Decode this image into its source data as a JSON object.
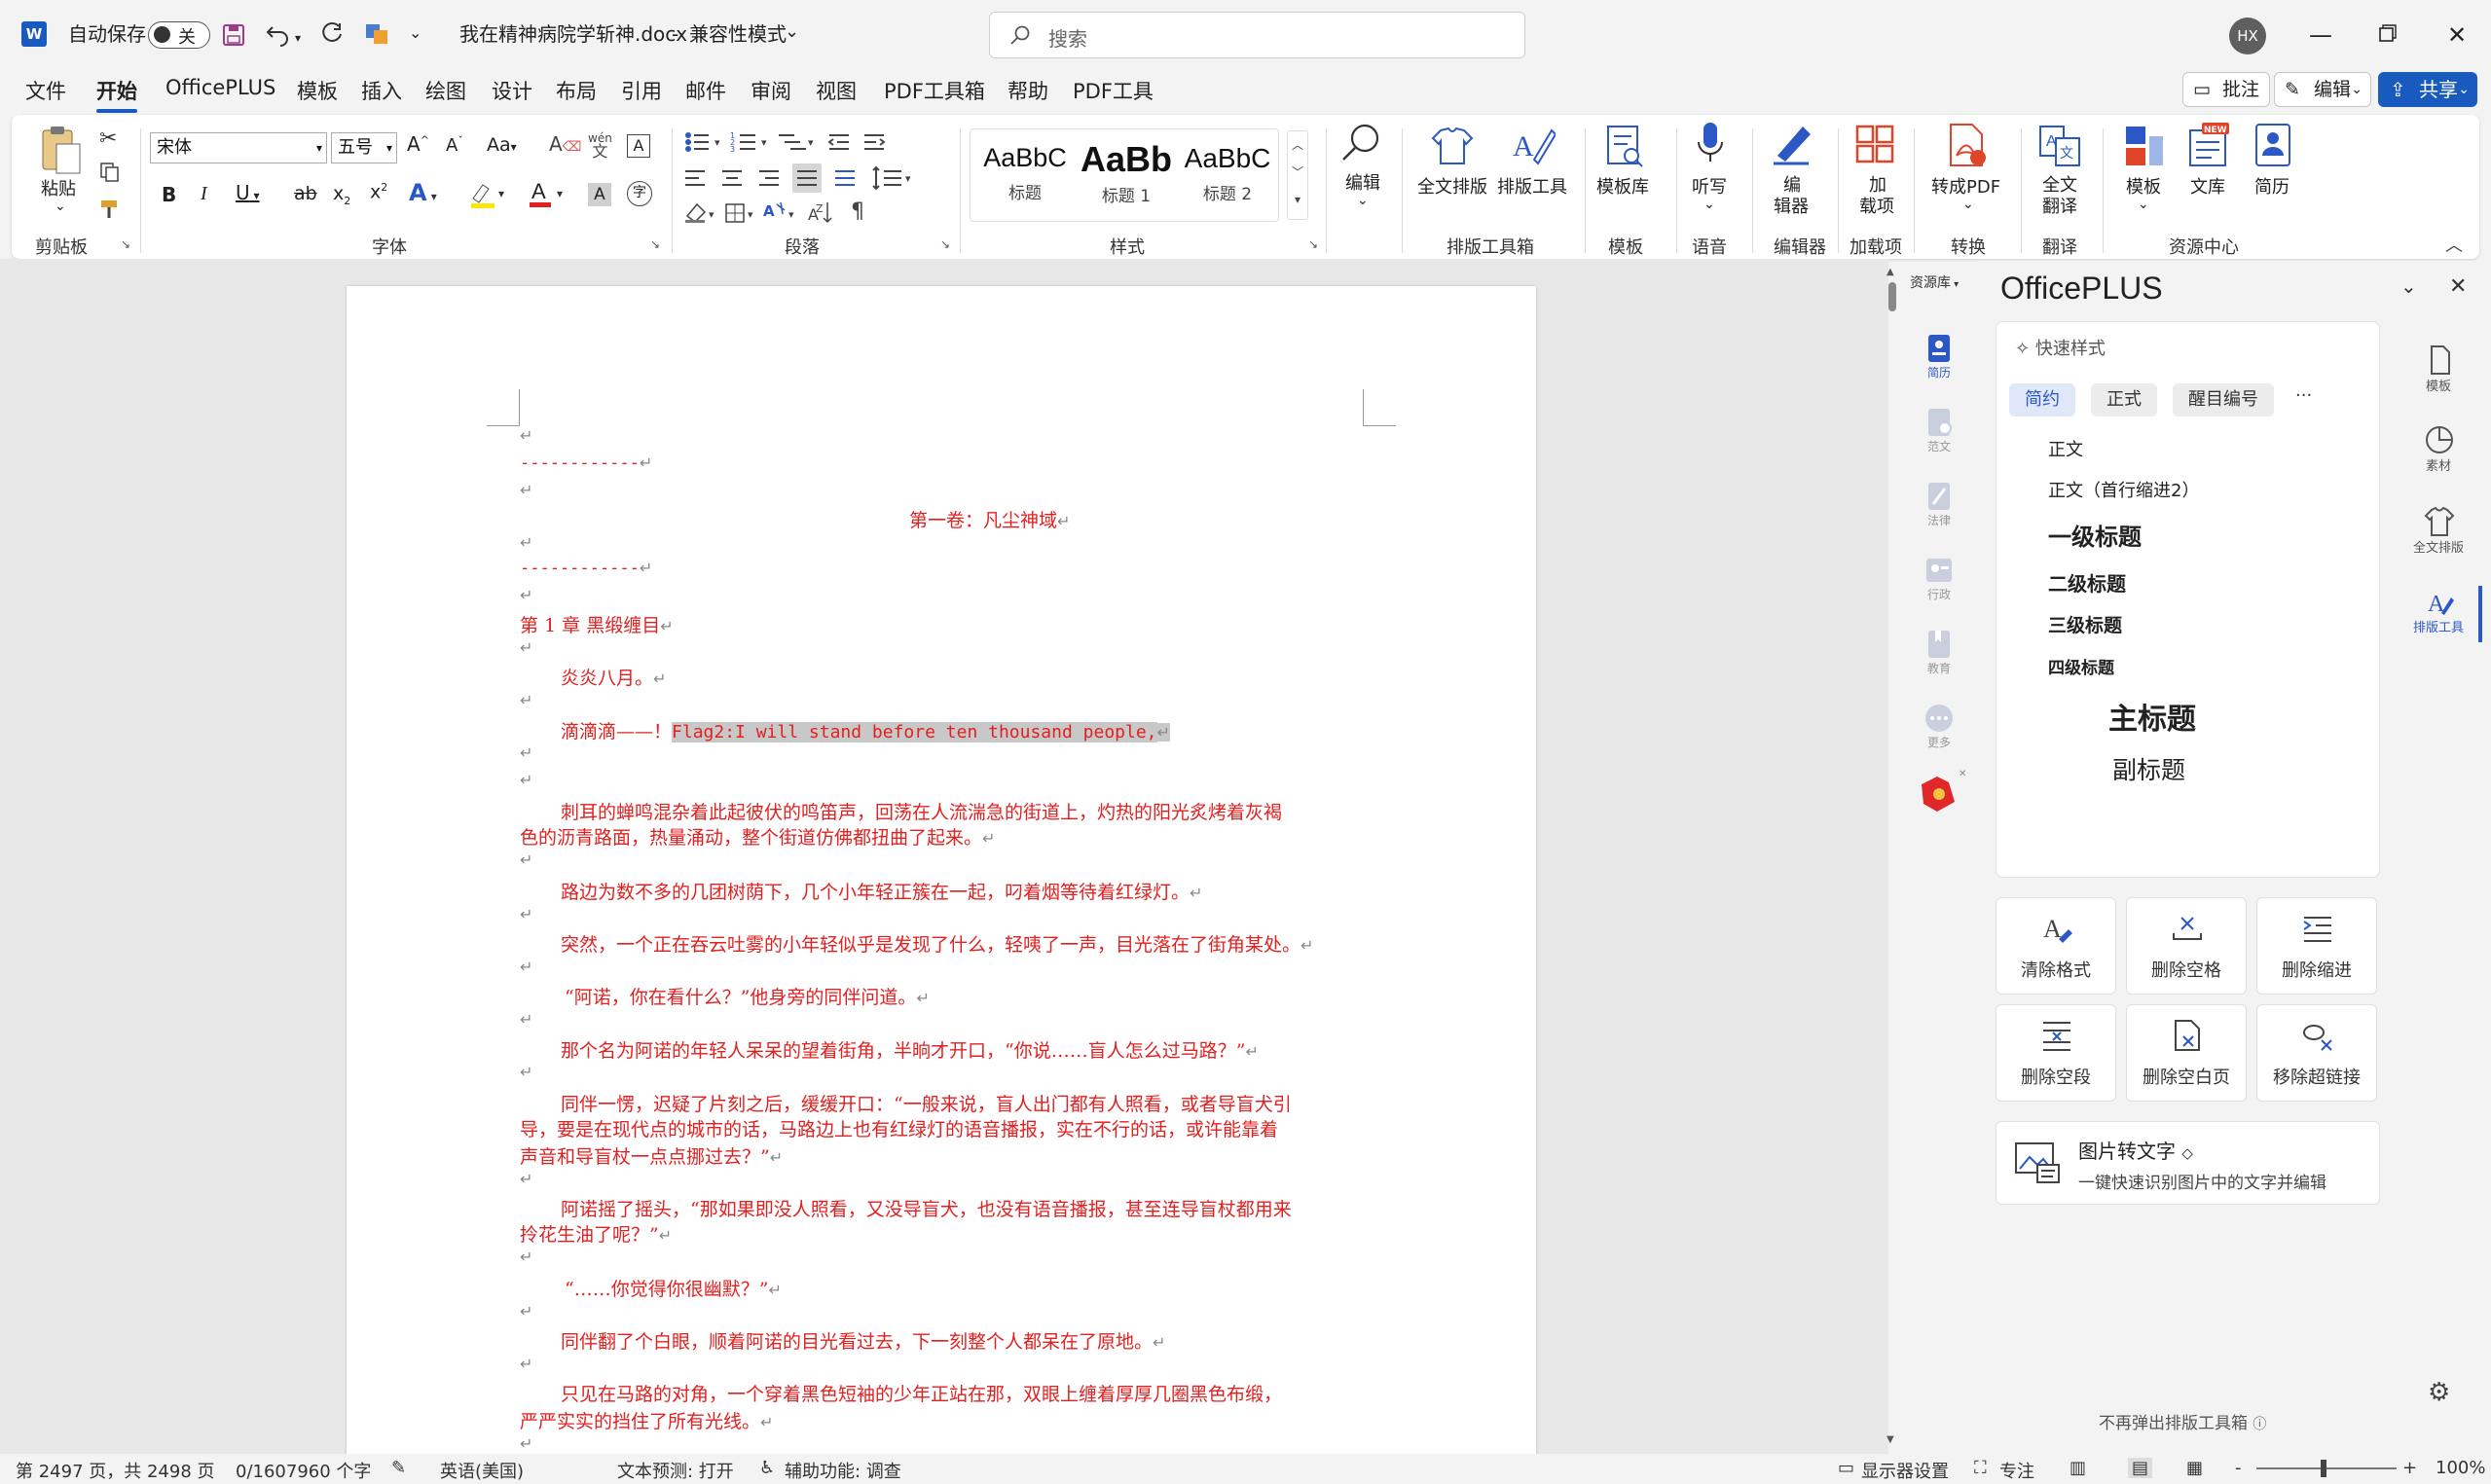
{
  "titlebar": {
    "autosave_label": "自动保存",
    "autosave_state": "关",
    "doc_title": "我在精神病院学斩神.docx",
    "separator": "-",
    "mode": "兼容性模式",
    "search_placeholder": "搜索",
    "user_initials": "HX"
  },
  "menu": {
    "items": [
      "文件",
      "开始",
      "OfficePLUS",
      "模板",
      "插入",
      "绘图",
      "设计",
      "布局",
      "引用",
      "邮件",
      "审阅",
      "视图",
      "PDF工具箱",
      "帮助",
      "PDF工具"
    ],
    "active": "开始",
    "comment_label": "批注",
    "edit_label": "编辑",
    "share_label": "共享"
  },
  "ribbon": {
    "clipboard": {
      "paste": "粘贴",
      "group": "剪贴板"
    },
    "font": {
      "name": "宋体",
      "size": "五号",
      "group": "字体"
    },
    "paragraph": {
      "group": "段落"
    },
    "styles": {
      "items": [
        {
          "preview": "AaBbC",
          "name": "标题"
        },
        {
          "preview": "AaBb",
          "name": "标题 1"
        },
        {
          "preview": "AaBbC",
          "name": "标题 2"
        }
      ],
      "group": "样式"
    },
    "editing": {
      "label": "编辑"
    },
    "typesetting": {
      "full": "全文排版",
      "tools": "排版工具",
      "group": "排版工具箱"
    },
    "template": {
      "label": "模板库",
      "group": "模板"
    },
    "voice": {
      "label": "听写",
      "group": "语音"
    },
    "editor": {
      "label1": "编",
      "label2": "辑器",
      "group": "编辑器"
    },
    "addins": {
      "label1": "加",
      "label2": "载项",
      "group": "加载项"
    },
    "convert": {
      "label": "转成PDF",
      "group": "转换"
    },
    "translate": {
      "label1": "全文",
      "label2": "翻译",
      "group": "翻译"
    },
    "resources": {
      "template": "模板",
      "library": "文库",
      "resume": "简历",
      "group": "资源中心",
      "new_badge": "NEW"
    }
  },
  "document": {
    "dashes": "------------",
    "volume_title": "第一卷：凡尘神域",
    "chapter_title": "第 1 章 黑缎缠目",
    "p1": "炎炎八月。",
    "p2_prefix": "滴滴滴——！",
    "p2_code": "Flag2:I will stand before ten thousand people,",
    "p3a": "刺耳的蝉鸣混杂着此起彼伏的鸣笛声，回荡在人流湍急的街道上，灼热的阳光炙烤着灰褐",
    "p3b": "色的沥青路面，热量涌动，整个街道仿佛都扭曲了起来。",
    "p4": "路边为数不多的几团树荫下，几个小年轻正簇在一起，叼着烟等待着红绿灯。",
    "p5": "突然，一个正在吞云吐雾的小年轻似乎是发现了什么，轻咦了一声，目光落在了街角某处。",
    "p6": "“阿诺，你在看什么？”他身旁的同伴问道。",
    "p7": "那个名为阿诺的年轻人呆呆的望着街角，半晌才开口，“你说……盲人怎么过马路？”",
    "p8a": "同伴一愣，迟疑了片刻之后，缓缓开口：“一般来说，盲人出门都有人照看，或者导盲犬引",
    "p8b": "导，要是在现代点的城市的话，马路边上也有红绿灯的语音播报，实在不行的话，或许能靠着",
    "p8c": "声音和导盲杖一点点挪过去？”",
    "p9a": "阿诺摇了摇头，“那如果即没人照看，又没导盲犬，也没有语音播报，甚至连导盲杖都用来",
    "p9b": "拎花生油了呢？”",
    "p10": "“……你觉得你很幽默？”",
    "p11": "同伴翻了个白眼，顺着阿诺的目光看过去，下一刻整个人都呆在了原地。",
    "p12a": "只见在马路的对角，一个穿着黑色短袖的少年正站在那，双眼上缠着厚厚几圈黑色布缎，",
    "p12b": "严严实实的挡住了所有光线。",
    "para_mark": "↵"
  },
  "side_icons": [
    {
      "label": "资源库"
    },
    {
      "label": "简历"
    },
    {
      "label": "范文"
    },
    {
      "label": "法律"
    },
    {
      "label": "行政"
    },
    {
      "label": "教育"
    },
    {
      "label": "更多"
    }
  ],
  "pane": {
    "title": "OfficePLUS",
    "quick_style": "快速样式",
    "tabs": [
      "简约",
      "正式",
      "醒目编号"
    ],
    "more": "···",
    "styles": [
      "正文",
      "正文（首行缩进2）",
      "一级标题",
      "二级标题",
      "三级标题",
      "四级标题",
      "主标题",
      "副标题"
    ],
    "tools": [
      "清除格式",
      "删除空格",
      "删除缩进",
      "删除空段",
      "删除空白页",
      "移除超链接"
    ],
    "img2txt_title": "图片转文字",
    "img2txt_desc": "一键快速识别图片中的文字并编辑",
    "no_popup": "不再弹出排版工具箱"
  },
  "right_rail": [
    {
      "label": "模板"
    },
    {
      "label": "素材"
    },
    {
      "label": "全文排版"
    },
    {
      "label": "排版工具"
    }
  ],
  "status": {
    "page": "第 2497 页，共 2498 页",
    "words": "0/1607960 个字",
    "lang": "英语(美国)",
    "predict": "文本预测: 打开",
    "access": "辅助功能: 调查",
    "display": "显示器设置",
    "focus": "专注",
    "zoom": "100%",
    "minus": "-",
    "plus": "+"
  },
  "colors": {
    "accent": "#185abd",
    "doc_text": "#e32020",
    "highlight": "#c8c8c8"
  }
}
